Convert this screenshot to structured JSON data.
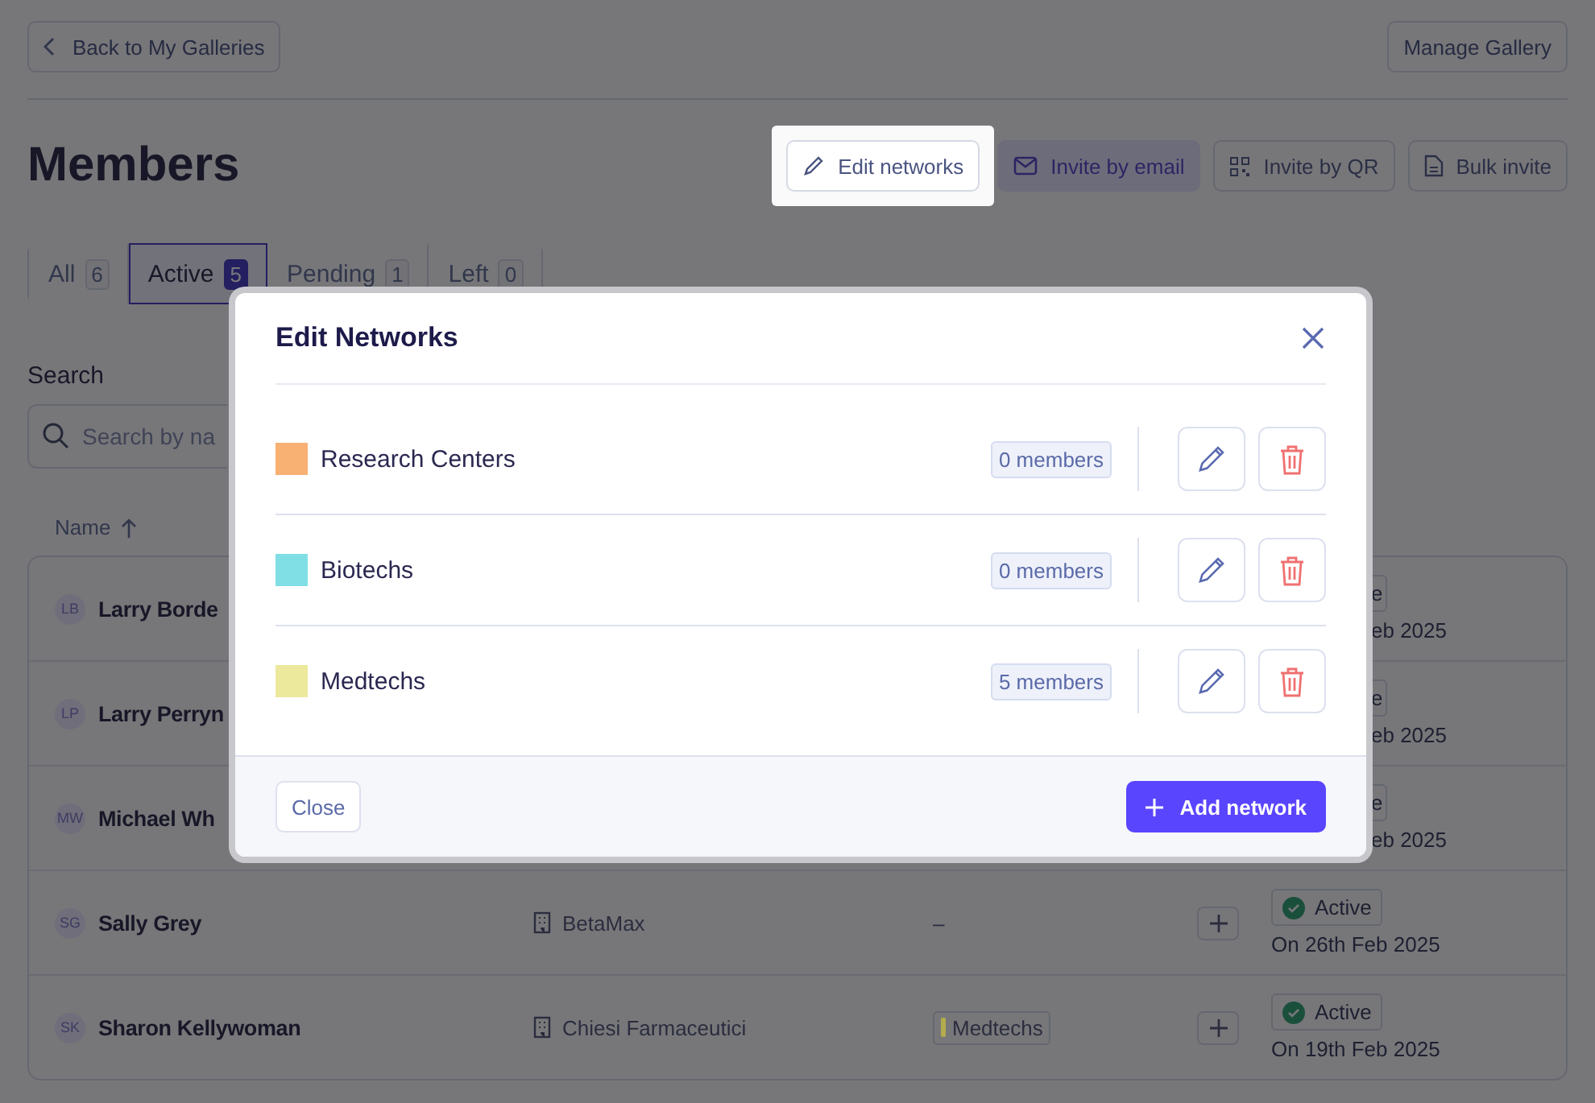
{
  "top_bar": {
    "back_button": "Back to My Galleries",
    "manage_button": "Manage Gallery"
  },
  "page_title": "Members",
  "actions": [
    {
      "kind": "edit",
      "label": "Edit networks",
      "highlighted": true,
      "primary": false
    },
    {
      "kind": "email",
      "label": "Invite by email",
      "highlighted": false,
      "primary": true
    },
    {
      "kind": "qr",
      "label": "Invite by QR",
      "highlighted": false,
      "primary": false
    },
    {
      "kind": "file",
      "label": "Bulk invite",
      "highlighted": false,
      "primary": false
    }
  ],
  "tabs": [
    {
      "label": "All",
      "count": "6",
      "selected": false
    },
    {
      "label": "Active",
      "count": "5",
      "selected": true
    },
    {
      "label": "Pending",
      "count": "1",
      "selected": false
    },
    {
      "label": "Left",
      "count": "0",
      "selected": false
    }
  ],
  "search": {
    "label": "Search",
    "placeholder": "Search by na"
  },
  "table": {
    "columns": [
      {
        "label": "Name",
        "sorted": true
      }
    ],
    "rows": [
      {
        "kind": "partial",
        "initials": "LB",
        "name": "Larry Borde",
        "status": {
          "label": "e",
          "date": "eb 2025"
        }
      },
      {
        "kind": "partial",
        "initials": "LP",
        "name": "Larry Perryn",
        "status": {
          "label": "e",
          "date": "eb 2025"
        }
      },
      {
        "kind": "partial",
        "initials": "MW",
        "name": "Michael Wh",
        "status": {
          "label": "e",
          "date": "eb 2025"
        }
      },
      {
        "kind": "full",
        "initials": "SG",
        "name": "Sally Grey",
        "company": "BetaMax",
        "networks": [],
        "empty_networks": "–",
        "status": {
          "label": "Active",
          "date": "On 26th Feb 2025"
        }
      },
      {
        "kind": "full",
        "initials": "SK",
        "name": "Sharon Kellywoman",
        "company": "Chiesi Farmaceutici",
        "networks": [
          {
            "label": "Medtechs",
            "color": "#b3ac4c"
          }
        ],
        "status": {
          "label": "Active",
          "date": "On 19th Feb 2025"
        }
      }
    ]
  },
  "modal": {
    "title": "Edit Networks",
    "networks": [
      {
        "name": "Research Centers",
        "color": "#f8b073",
        "count": "0 members"
      },
      {
        "name": "Biotechs",
        "color": "#80dfe4",
        "count": "0 members"
      },
      {
        "name": "Medtechs",
        "color": "#ece89c",
        "count": "5 members"
      }
    ],
    "close_button": "Close",
    "add_button": "Add network"
  }
}
